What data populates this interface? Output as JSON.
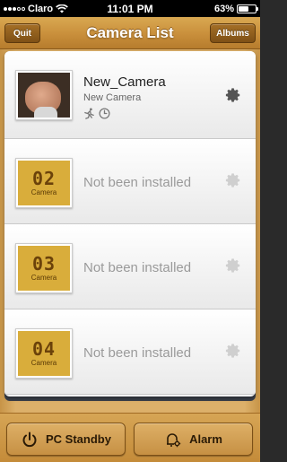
{
  "status_bar": {
    "carrier": "Claro",
    "time": "11:01 PM",
    "battery": "63%",
    "battery_level": 0.63
  },
  "nav": {
    "title": "Camera List",
    "left_button": "Quit",
    "right_button": "Albums"
  },
  "cameras": [
    {
      "name": "New_Camera",
      "subtitle": "New Camera",
      "icons": [
        "motion-icon",
        "clock-icon"
      ]
    },
    {
      "slot_number": "02",
      "slot_label": "Camera",
      "status": "Not been installed"
    },
    {
      "slot_number": "03",
      "slot_label": "Camera",
      "status": "Not been installed"
    },
    {
      "slot_number": "04",
      "slot_label": "Camera",
      "status": "Not been installed"
    }
  ],
  "bottom_bar": {
    "pc_standby_label": "PC Standby",
    "alarm_label": "Alarm"
  },
  "colors": {
    "wood_light": "#d9a852",
    "wood_dark": "#b67c2d",
    "slot_gold": "#d9ad3b",
    "inactive_text": "#9a9a9a"
  }
}
